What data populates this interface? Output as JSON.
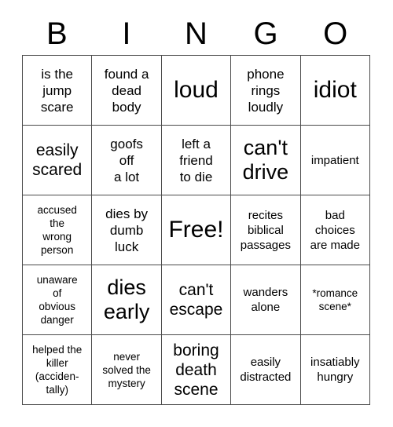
{
  "card": {
    "header_letters": [
      "B",
      "I",
      "N",
      "G",
      "O"
    ],
    "background_color": "#ffffff",
    "border_color": "#4a4a4a",
    "text_color": "#000000",
    "grid_size": "5x5",
    "rows": [
      [
        {
          "text": "is the\njump\nscare",
          "size": "fs-sm"
        },
        {
          "text": "found a\ndead\nbody",
          "size": "fs-sm"
        },
        {
          "text": "loud",
          "size": "fs-xl"
        },
        {
          "text": "phone\nrings\nloudly",
          "size": "fs-sm"
        },
        {
          "text": "idiot",
          "size": "fs-xl"
        }
      ],
      [
        {
          "text": "easily\nscared",
          "size": "fs-md"
        },
        {
          "text": "goofs\noff\na lot",
          "size": "fs-sm"
        },
        {
          "text": "left a\nfriend\nto die",
          "size": "fs-sm"
        },
        {
          "text": "can't\ndrive",
          "size": "fs-lg"
        },
        {
          "text": "impatient",
          "size": "fs-xs"
        }
      ],
      [
        {
          "text": "accused\nthe\nwrong\nperson",
          "size": "fs-xxs"
        },
        {
          "text": "dies by\ndumb\nluck",
          "size": "fs-sm"
        },
        {
          "text": "Free!",
          "size": "fs-xl"
        },
        {
          "text": "recites\nbiblical\npassages",
          "size": "fs-xs"
        },
        {
          "text": "bad\nchoices\nare made",
          "size": "fs-xs"
        }
      ],
      [
        {
          "text": "unaware\nof\nobvious\ndanger",
          "size": "fs-xxs"
        },
        {
          "text": "dies\nearly",
          "size": "fs-lg"
        },
        {
          "text": "can't\nescape",
          "size": "fs-md"
        },
        {
          "text": "wanders\nalone",
          "size": "fs-xs"
        },
        {
          "text": "*romance\nscene*",
          "size": "fs-xxs"
        }
      ],
      [
        {
          "text": "helped the\nkiller\n(acciden-\ntally)",
          "size": "fs-xxs"
        },
        {
          "text": "never\nsolved the\nmystery",
          "size": "fs-xxs"
        },
        {
          "text": "boring\ndeath\nscene",
          "size": "fs-md"
        },
        {
          "text": "easily\ndistracted",
          "size": "fs-xs"
        },
        {
          "text": "insatiably\nhungry",
          "size": "fs-xs"
        }
      ]
    ]
  }
}
